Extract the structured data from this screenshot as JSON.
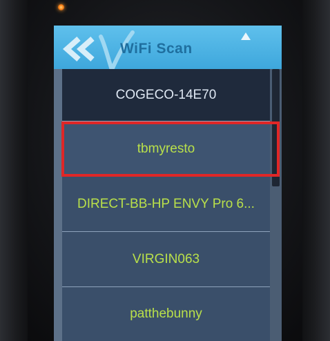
{
  "title": "WiFi Scan",
  "icons": {
    "back": "double-chevron-left-icon",
    "scroll_up": "chevron-up-icon",
    "logo": "v-logo-icon"
  },
  "networks": [
    {
      "ssid": "COGECO-14E70"
    },
    {
      "ssid": "tbmyresto"
    },
    {
      "ssid": "DIRECT-BB-HP ENVY Pro 6..."
    },
    {
      "ssid": "VIRGIN063"
    },
    {
      "ssid": "patthebunny"
    }
  ],
  "colors": {
    "titlebar": "#3ea7dc",
    "list_text": "#b9e04a",
    "highlight": "#e02727"
  }
}
